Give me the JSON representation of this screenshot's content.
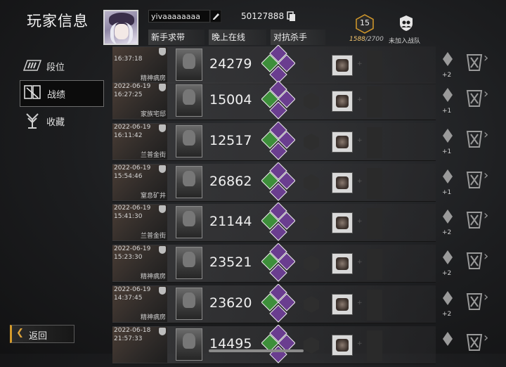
{
  "header": {
    "title": "玩家信息",
    "username": "yivaaaaaaaa",
    "player_id": "50127888",
    "tags": [
      "新手求带",
      "晚上在线",
      "对抗杀手"
    ],
    "level": "15",
    "level_progress_current": "1588",
    "level_progress_total": "/2700",
    "team_status": "未加入战队"
  },
  "sidebar": {
    "items": [
      {
        "label": "段位",
        "icon": "rank-icon"
      },
      {
        "label": "战绩",
        "icon": "record-icon",
        "selected": true
      },
      {
        "label": "收藏",
        "icon": "collection-icon"
      }
    ]
  },
  "back_label": "返回",
  "matches": [
    {
      "date": "",
      "time": "16:37:18",
      "map": "精神病房",
      "score": "24279",
      "pips": "+2"
    },
    {
      "date": "2022-06-19",
      "time": "16:27:25",
      "map": "家族宅邸",
      "score": "15004",
      "pips": "+1"
    },
    {
      "date": "2022-06-19",
      "time": "16:11:42",
      "map": "兰普金街",
      "score": "12517",
      "pips": "+1"
    },
    {
      "date": "2022-06-19",
      "time": "15:54:46",
      "map": "窒息矿井",
      "score": "26862",
      "pips": "+1"
    },
    {
      "date": "2022-06-19",
      "time": "15:41:30",
      "map": "兰普金街",
      "score": "21144",
      "pips": "+2"
    },
    {
      "date": "2022-06-19",
      "time": "15:23:30",
      "map": "精神病房",
      "score": "23521",
      "pips": "+2"
    },
    {
      "date": "2022-06-19",
      "time": "14:37:45",
      "map": "精神病房",
      "score": "23620",
      "pips": "+2"
    },
    {
      "date": "2022-06-18",
      "time": "21:57:33",
      "map": "",
      "score": "14495",
      "pips": ""
    }
  ],
  "colors": {
    "accent_gold": "#d59a2a",
    "perk_green": "#3d8f3a",
    "perk_purple": "#6a3d8f",
    "text": "#e6e6e6"
  }
}
